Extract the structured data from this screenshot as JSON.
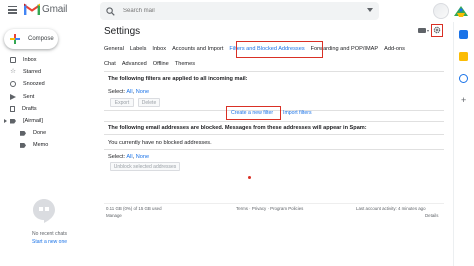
{
  "header": {
    "app_name": "Gmail",
    "search_placeholder": "Search mail"
  },
  "compose": {
    "label": "Compose"
  },
  "sidebar": {
    "items": [
      {
        "label": "Inbox",
        "icon": "inbox-icon"
      },
      {
        "label": "Starred",
        "icon": "star-icon"
      },
      {
        "label": "Snoozed",
        "icon": "clock-icon"
      },
      {
        "label": "Sent",
        "icon": "send-icon"
      },
      {
        "label": "Drafts",
        "icon": "draft-icon"
      },
      {
        "label": "[Airmail]",
        "icon": "label-icon"
      },
      {
        "label": "Done",
        "icon": "label-icon"
      },
      {
        "label": "Memo",
        "icon": "label-icon"
      }
    ]
  },
  "hangouts": {
    "no_chats": "No recent chats",
    "start_new": "Start a new one"
  },
  "settings": {
    "title": "Settings",
    "tabs_row1": [
      "General",
      "Labels",
      "Inbox",
      "Accounts and Import",
      "Filters and Blocked Addresses",
      "Forwarding and POP/IMAP",
      "Add-ons"
    ],
    "active_tab": "Filters and Blocked Addresses",
    "tabs_row2": [
      "Chat",
      "Advanced",
      "Offline",
      "Themes"
    ]
  },
  "filters": {
    "heading": "The following filters are applied to all incoming mail:",
    "select_label": "Select:",
    "select_all": "All",
    "select_none": "None",
    "export_label": "Export",
    "delete_label": "Delete",
    "create_filter": "Create a new filter",
    "import_filters": "Import filters"
  },
  "blocked": {
    "heading": "The following email addresses are blocked. Messages from these addresses will appear in Spam:",
    "empty_text": "You currently have no blocked addresses.",
    "select_label": "Select:",
    "select_all": "All",
    "select_none": "None",
    "unblock_label": "Unblock selected addresses"
  },
  "footer": {
    "storage": "0.11 GB (0%) of 15 GB used",
    "manage": "Manage",
    "links": "Terms · Privacy · Program Policies",
    "activity": "Last account activity: 4 minutes ago",
    "details": "Details"
  },
  "colors": {
    "accent": "#1a73e8",
    "highlight_box": "#d93025"
  }
}
